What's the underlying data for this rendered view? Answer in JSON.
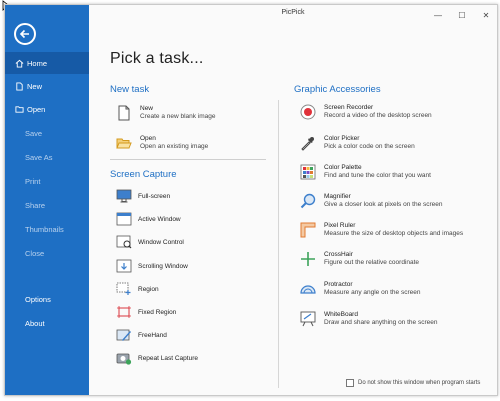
{
  "window": {
    "title": "PicPick"
  },
  "sidebar": {
    "items": [
      {
        "label": "Home"
      },
      {
        "label": "New"
      },
      {
        "label": "Open"
      },
      {
        "label": "Save"
      },
      {
        "label": "Save As"
      },
      {
        "label": "Print"
      },
      {
        "label": "Share"
      },
      {
        "label": "Thumbnails"
      },
      {
        "label": "Close"
      },
      {
        "label": "Options"
      },
      {
        "label": "About"
      }
    ]
  },
  "main": {
    "title": "Pick a task...",
    "new_task": {
      "heading": "New task",
      "items": [
        {
          "title": "New",
          "desc": "Create a new blank image"
        },
        {
          "title": "Open",
          "desc": "Open an existing image"
        }
      ]
    },
    "screen_capture": {
      "heading": "Screen Capture",
      "items": [
        {
          "label": "Full-screen"
        },
        {
          "label": "Active Window"
        },
        {
          "label": "Window Control"
        },
        {
          "label": "Scrolling Window"
        },
        {
          "label": "Region"
        },
        {
          "label": "Fixed Region"
        },
        {
          "label": "FreeHand"
        },
        {
          "label": "Repeat Last Capture"
        }
      ]
    },
    "graphic_accessories": {
      "heading": "Graphic Accessories",
      "items": [
        {
          "title": "Screen Recorder",
          "desc": "Record a video of the desktop screen"
        },
        {
          "title": "Color Picker",
          "desc": "Pick a color code on the screen"
        },
        {
          "title": "Color Palette",
          "desc": "Find and tune the color that you want"
        },
        {
          "title": "Magnifier",
          "desc": "Give a closer look at pixels on the screen"
        },
        {
          "title": "Pixel Ruler",
          "desc": "Measure the size of desktop objects and images"
        },
        {
          "title": "CrossHair",
          "desc": "Figure out the relative coordinate"
        },
        {
          "title": "Protractor",
          "desc": "Measure any angle on the screen"
        },
        {
          "title": "WhiteBoard",
          "desc": "Draw and share anything on the screen"
        }
      ]
    }
  },
  "footer": {
    "checkbox_label": "Do not show this window when program starts",
    "checked": false
  },
  "colors": {
    "sidebar": "#1e6fc4",
    "sidebar_active": "#165aa6",
    "accent": "#1e6fc4"
  }
}
